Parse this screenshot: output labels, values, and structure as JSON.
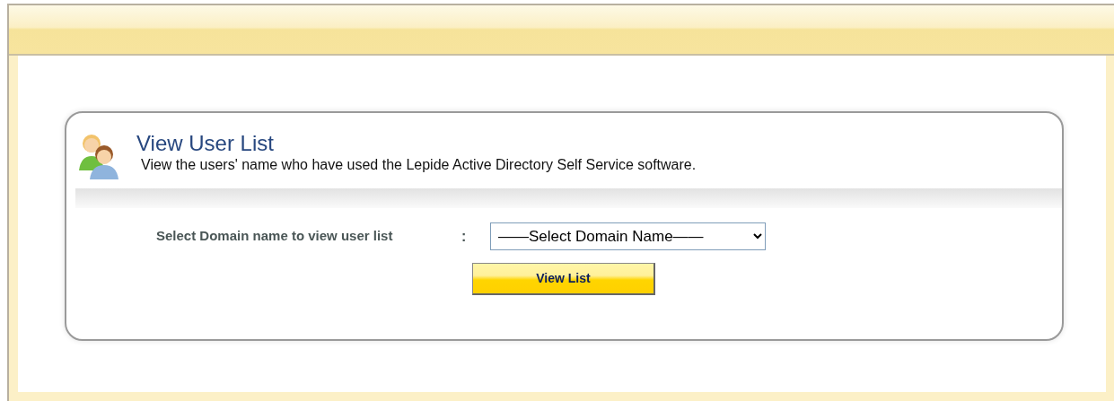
{
  "panel": {
    "title": "View User List",
    "description": "View the users' name who have used the Lepide Active Directory Self Service software."
  },
  "form": {
    "label": "Select Domain name to view user list",
    "separator": ":",
    "domain_select": {
      "value": "——Select Domain Name——"
    }
  },
  "buttons": [
    {
      "label": "View List"
    }
  ]
}
